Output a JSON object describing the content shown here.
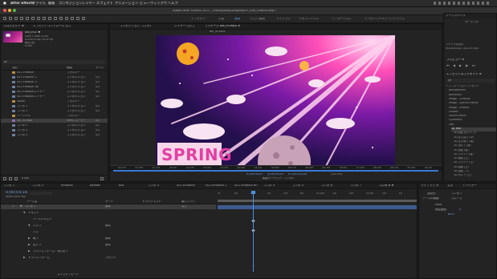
{
  "menubar": {
    "app": "After Effects",
    "items": [
      "ファイル",
      "編集",
      "コンポジション",
      "レイヤー",
      "エフェクト",
      "アニメーション",
      "ビュー",
      "ウィンドウ",
      "ヘルプ"
    ]
  },
  "titlebar": {
    "title": "Adobe After Effects 2021 - /Users/jonas/Dropbox/PC_Ewi_motion.aep *"
  },
  "workspaces": [
    "デフォルト",
    "学習",
    "標準",
    "小さい画面",
    "ライブラリ",
    "テキストパネル",
    "アニメーション",
    "エッセンシャルグラフィックス"
  ],
  "project": {
    "tab": "プロジェクト ≡",
    "tab2": "エフェクトコントロール なし",
    "file_name": "Bal_ini-E ▼",
    "file_meta": [
      "1920 x 1080 (1.00)",
      "Δ 0;00;10;00, 29.97 fps",
      "数百万色",
      "H.264"
    ],
    "search_placeholder": "ρ▾",
    "col_name": "名前",
    "col_type": "種類",
    "col_size": "サイズ",
    "items": [
      {
        "icon": "f",
        "name": "002 Emotion",
        "type": "フォルダー",
        "size": ""
      },
      {
        "icon": "c",
        "name": "002 Emotion 2",
        "type": "コンポジション",
        "size": "0,0"
      },
      {
        "icon": "c",
        "name": "002 Emotion 3",
        "type": "コンポジション",
        "size": "0,0"
      },
      {
        "icon": "c",
        "name": "002 Emotion fin",
        "type": "コンポジション",
        "size": "0,0"
      },
      {
        "icon": "c",
        "name": "002 Emotionレイヤー",
        "type": "コンポジション",
        "size": "0,0"
      },
      {
        "icon": "c",
        "name": "002 Emotionレイヤー",
        "type": "コンポジション",
        "size": "0,0"
      },
      {
        "icon": "f",
        "name": "Solids",
        "type": "フォルダー",
        "size": ""
      },
      {
        "icon": "c",
        "name": "コンポ 1",
        "type": "コンポジション",
        "size": "0,0"
      },
      {
        "icon": "c",
        "name": "コンポ 2",
        "type": "コンポジション",
        "size": "0,0"
      },
      {
        "icon": "f",
        "name": "ソーシャル",
        "type": "フォルダー",
        "size": ""
      },
      {
        "icon": "v",
        "name": "bal_ini.mp4",
        "type": "MPEG ムービー",
        "size": "0,0"
      },
      {
        "icon": "c",
        "name": "コンポ 3",
        "type": "コンポジション",
        "size": "0,0"
      },
      {
        "icon": "c",
        "name": "コンポ 4",
        "type": "コンポジション",
        "size": "0,0"
      },
      {
        "icon": "c",
        "name": "コンポ 5",
        "type": "コンポジション",
        "size": "0,0"
      }
    ],
    "bpc": "8 bpc"
  },
  "viewer": {
    "tabs": [
      "コンポジション コンポ1",
      "レイヤー (なし)",
      "フッテージ bal_ini.mp4 ≡"
    ],
    "breadcrumb": "bal_ini.mp4",
    "spring": "SPRING",
    "timecode": "0;00;00;00",
    "timecode2": "0;00;09;29",
    "timecode3": "Δ 0;00;10;00",
    "zoom": "(33.3%)",
    "edit_label": "編集ターゲット：コンポ1",
    "ruler": [
      "00;15f",
      "01;00f",
      "01;15f",
      "02;00f",
      "02;15f",
      "03;00f",
      "03;15f",
      "04;00f",
      "04;15f",
      "05;00f",
      "05;15f",
      "06;00f",
      "06;15f",
      "07;00f",
      "07;15f",
      "08;00f",
      "08;15f",
      "09;00f",
      "09;15f"
    ]
  },
  "right_panel": {
    "tab1": "ワークスペース",
    "tab2": "オーディオ",
    "file_info_label": "ファイルを表示",
    "file_path": "/Users/jonas/.../bal_ini.mp4",
    "preview_tab": "プレビュー ≡",
    "effects_tab": "エフェクト＆プリセット ≡",
    "search_placeholder": "ρ▾",
    "tree": [
      {
        "indent": 0,
        "label": "* アニメーションプリセット"
      },
      {
        "indent": 1,
        "label": "Backgrounds"
      },
      {
        "indent": 1,
        "label": "Behaviors"
      },
      {
        "indent": 1,
        "label": "Image - Creative"
      },
      {
        "indent": 1,
        "label": "Image - Special Effects"
      },
      {
        "indent": 1,
        "label": "Image - Utilities"
      },
      {
        "indent": 1,
        "label": "Shapes"
      },
      {
        "indent": 1,
        "label": "Sound Effects"
      },
      {
        "indent": 1,
        "label": "Synthetics"
      },
      {
        "indent": 1,
        "label": "Text"
      },
      {
        "indent": 2,
        "label": "3D Text"
      },
      {
        "indent": 3,
        "label": "3D 回転 (ゆっくり)"
      },
      {
        "indent": 3,
        "label": "3D ぱらぱら (ゆ)"
      },
      {
        "indent": 3,
        "label": "3D 文字落下 (落)"
      },
      {
        "indent": 3,
        "label": "3D 流れて (落)"
      },
      {
        "indent": 3,
        "label": "3D 回転 (落)"
      },
      {
        "indent": 3,
        "label": "3D スペイン (落)"
      },
      {
        "indent": 3,
        "label": "3D 爆発 (上)"
      },
      {
        "indent": 3,
        "label": "3D スライド (上)"
      },
      {
        "indent": 3,
        "label": "3D 曲線 (上)"
      },
      {
        "indent": 3,
        "label": "3D 回転 ...ズ"
      },
      {
        "indent": 3,
        "label": "3D ボルト (上)"
      }
    ]
  },
  "timeline": {
    "comp_tabs": [
      "コンポ 1",
      "コンポ 2",
      "emotion",
      "palette",
      "bus",
      "コンポ 3",
      "002 Emotion",
      "002 Emotion 2",
      "002 Emotion fin",
      "コンポ 4",
      "コンポ 5",
      "コンポ 6",
      "コンポ 7",
      "コンポ 8 ≡"
    ],
    "timecode": "0;00;03;16",
    "fps_label": "00106 (29.97 fps)",
    "col_source": "ソース名",
    "col_mode": "モード",
    "col_trkmat": "トラックマット",
    "col_parent": "親とリンク",
    "layers": [
      {
        "num": "1",
        "name": "コンポ 1",
        "type": "text",
        "mode": "標準",
        "parent": "なし",
        "expand": "▼"
      },
      {
        "num": "",
        "name": "テキスト",
        "type": "sub",
        "mode": "",
        "parent": "",
        "expand": "▼"
      },
      {
        "num": "",
        "name": "ソーステキスト",
        "type": "prop",
        "mode": "",
        "parent": "",
        "expand": ""
      },
      {
        "num": "",
        "name": "パス 1",
        "type": "prop",
        "mode": "標準",
        "parent": "",
        "expand": "▼"
      },
      {
        "num": "",
        "name": "パス",
        "type": "prop",
        "mode": "",
        "parent": "",
        "expand": ""
      },
      {
        "num": "",
        "name": "線 1",
        "type": "prop",
        "mode": "標準",
        "parent": "",
        "expand": "▶"
      },
      {
        "num": "",
        "name": "塗り 1",
        "type": "prop",
        "mode": "標準",
        "parent": "",
        "expand": "▶"
      },
      {
        "num": "",
        "name": "トランスフォーム：長方形 1",
        "type": "prop",
        "mode": "",
        "parent": "",
        "expand": "▶"
      },
      {
        "num": "",
        "name": "トランスフォーム",
        "type": "sub",
        "mode": "リセット",
        "parent": "",
        "expand": "▶"
      }
    ],
    "ruler": [
      "0f",
      "10f",
      "20f",
      "01f",
      "10f",
      "20f",
      "02:00f",
      "10f",
      "20f",
      "03:00f",
      "10f",
      "20f"
    ],
    "footer": "スイッチ / モード",
    "playhead_label": ""
  },
  "graph_panel": {
    "tab": "ライブラリ ≡",
    "tab2": "文字",
    "tab3": "トラッカー",
    "rows": [
      {
        "label": "適用先：",
        "value": "コンポ 1"
      },
      {
        "label": "ソースの種類：",
        "value": "スムーズ"
      },
      {
        "label": "",
        "value": "Ease"
      },
      {
        "label": "開始速度：",
        "value": "0"
      },
      {
        "label": "",
        "value": "80%"
      }
    ]
  },
  "colors": {
    "accent": "#5f9fe8",
    "folder": "#b39045",
    "comp": "#6d7fa0",
    "video": "#8d6fb3",
    "layer_bar": "#3e5b8f"
  }
}
